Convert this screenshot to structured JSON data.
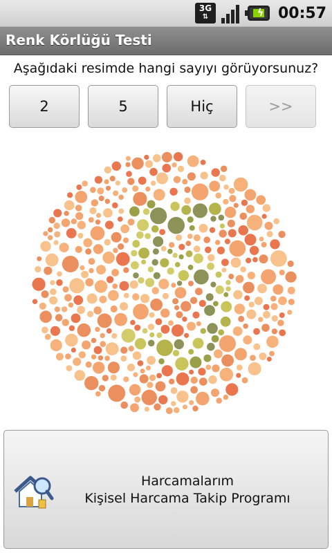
{
  "status_bar": {
    "network": "3G",
    "time": "00:57",
    "icons": [
      "3g-icon",
      "signal-icon",
      "battery-charging-icon"
    ]
  },
  "app": {
    "title": "Renk Körlüğü Testi"
  },
  "test": {
    "question": "Aşağıdaki resimde hangi sayıyı görüyorsunuz?",
    "answers": [
      {
        "label": "2",
        "enabled": true
      },
      {
        "label": "5",
        "enabled": true
      },
      {
        "label": "Hiç",
        "enabled": true
      },
      {
        "label": ">>",
        "enabled": false
      }
    ],
    "plate": {
      "icon": "ishihara-plate-image",
      "background_colors": [
        "#ec8f5e",
        "#f4a46e",
        "#f8c28c",
        "#e9764f",
        "#f6b27a"
      ],
      "figure_colors": [
        "#b4b34c",
        "#9aa048",
        "#c8c65a",
        "#8c9258",
        "#d2cc6a"
      ]
    }
  },
  "promo": {
    "icon": "house-magnifier-icon",
    "title": "Harcamalarım",
    "subtitle": "Kişisel Harcama Takip Programı"
  }
}
